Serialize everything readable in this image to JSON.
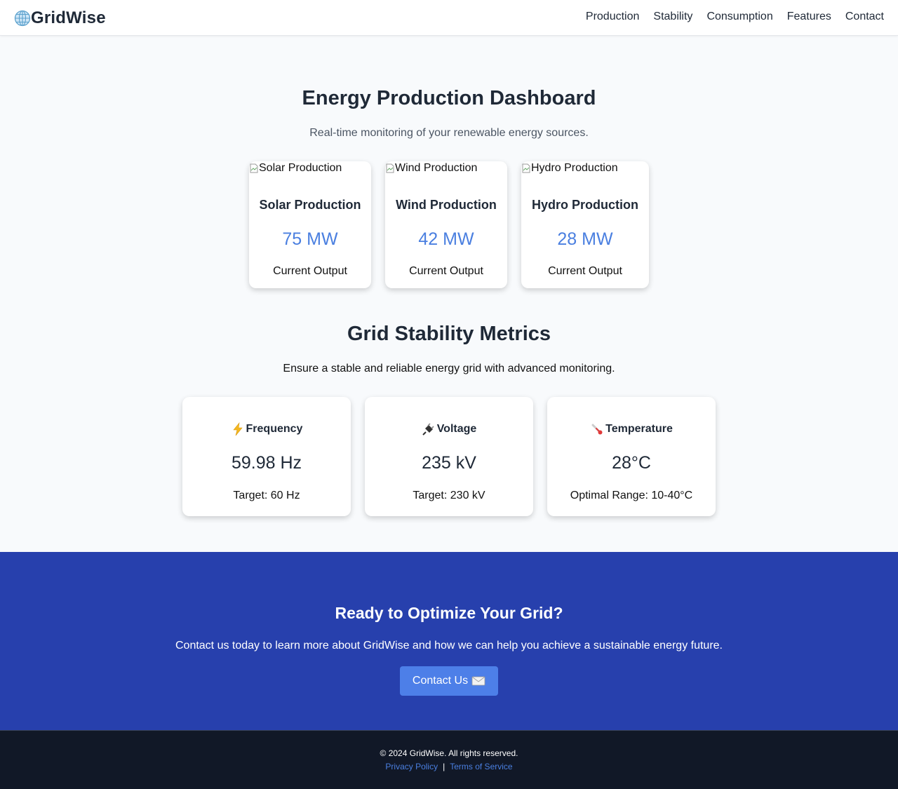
{
  "header": {
    "brand": "GridWise",
    "nav": [
      "Production",
      "Stability",
      "Consumption",
      "Features",
      "Contact"
    ]
  },
  "production": {
    "title": "Energy Production Dashboard",
    "subtitle": "Real-time monitoring of your renewable energy sources.",
    "cards": [
      {
        "alt": "Solar Production",
        "title": "Solar Production",
        "value": "75 MW",
        "label": "Current Output"
      },
      {
        "alt": "Wind Production",
        "title": "Wind Production",
        "value": "42 MW",
        "label": "Current Output"
      },
      {
        "alt": "Hydro Production",
        "title": "Hydro Production",
        "value": "28 MW",
        "label": "Current Output"
      }
    ]
  },
  "stability": {
    "title": "Grid Stability Metrics",
    "subtitle": "Ensure a stable and reliable energy grid with advanced monitoring.",
    "cards": [
      {
        "icon": "lightning-icon",
        "title": "Frequency",
        "value": "59.98 Hz",
        "note": "Target: 60 Hz"
      },
      {
        "icon": "plug-icon",
        "title": "Voltage",
        "value": "235 kV",
        "note": "Target: 230 kV"
      },
      {
        "icon": "thermometer-icon",
        "title": "Temperature",
        "value": "28°C",
        "note": "Optimal Range: 10-40°C"
      }
    ]
  },
  "cta": {
    "title": "Ready to Optimize Your Grid?",
    "text": "Contact us today to learn more about GridWise and how we can help you achieve a sustainable energy future.",
    "button": "Contact Us",
    "button_icon": "envelope-icon"
  },
  "footer": {
    "copyright": "© 2024 GridWise. All rights reserved.",
    "privacy": "Privacy Policy",
    "separator": "|",
    "terms": "Terms of Service"
  },
  "colors": {
    "accent": "#4a7fe0",
    "cta_bg": "#2740ad",
    "footer_bg": "#111827"
  }
}
